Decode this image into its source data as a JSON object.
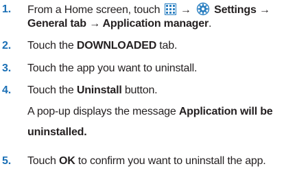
{
  "steps": [
    {
      "number": "1.",
      "line1_prefix": "From a Home screen, touch",
      "arrow": "→",
      "settings_label": "Settings",
      "line2_bold": "General tab → Application manager",
      "line2_end": ".",
      "icons": [
        "apps-grid-icon",
        "settings-gear-icon"
      ]
    },
    {
      "number": "2.",
      "prefix": "Touch the ",
      "bold": "DOWNLOADED",
      "suffix": " tab."
    },
    {
      "number": "3.",
      "text": "Touch the app you want to uninstall."
    },
    {
      "number": "4.",
      "prefix": "Touch the ",
      "bold": "Uninstall",
      "suffix": " button.",
      "note_prefix": "A pop-up displays the message ",
      "note_bold_line1": "Application will be",
      "note_bold_line2": "uninstalled."
    },
    {
      "number": "5.",
      "prefix": "Touch ",
      "bold": "OK",
      "suffix": " to confirm you want to uninstall the app."
    }
  ],
  "colors": {
    "step_number": "#1a6fb5",
    "icon_blue": "#2a7fc1",
    "text": "#231f20"
  }
}
